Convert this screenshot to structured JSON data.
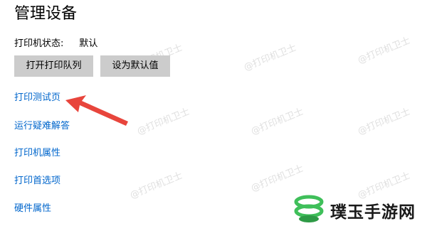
{
  "page": {
    "title": "管理设备"
  },
  "status": {
    "label": "打印机状态:",
    "value": "默认"
  },
  "buttons": {
    "open_queue": "打开打印队列",
    "set_default": "设为默认值"
  },
  "links": [
    "打印测试页",
    "运行疑难解答",
    "打印机属性",
    "打印首选项",
    "硬件属性"
  ],
  "watermark": "@打印机卫士",
  "brand": {
    "name": "璞玉手游网"
  },
  "colors": {
    "link": "#0066cc",
    "button": "#cccccc",
    "arrow": "#e8453c",
    "brand_green": "#3fbf5a"
  }
}
